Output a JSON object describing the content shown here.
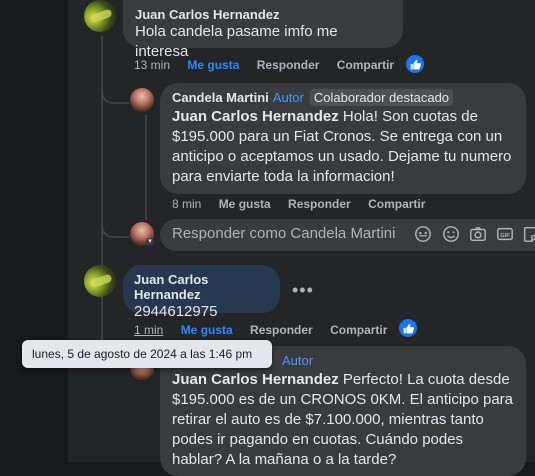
{
  "comment1": {
    "author": "Juan Carlos Hernandez",
    "text": "Hola candela pasame imfo me interesa",
    "actions": {
      "time": "13 min",
      "like": "Me gusta",
      "reply": "Responder",
      "share": "Compartir"
    }
  },
  "reply1": {
    "author": "Candela Martini",
    "author_badge": "Autor",
    "badge": "Colaborador destacado",
    "mention": "Juan Carlos Hernandez",
    "text": " Hola! Son cuotas de $195.000 para un Fiat Cronos. Se entrega con un anticipo o aceptamos un usado. Dejame tu numero para enviarte toda la informacion!",
    "actions": {
      "time": "8 min",
      "like": "Me gusta",
      "reply": "Responder",
      "share": "Compartir"
    }
  },
  "reply_input": {
    "placeholder": "Responder como Candela Martini"
  },
  "comment2": {
    "author": "Juan Carlos Hernandez",
    "text": "2944612975",
    "actions": {
      "time": "1 min",
      "like": "Me gusta",
      "reply": "Responder",
      "share": "Compartir"
    }
  },
  "reply2": {
    "author_badge": "Autor",
    "mention": "Juan Carlos Hernandez",
    "text": " Perfecto! La cuota desde $195.000 es de un CRONOS 0KM. El anticipo para retirar el auto es de $7.100.000, mientras tanto podes ir pagando en cuotas. Cuándo podes hablar? A la mañana o a la tarde?"
  },
  "tooltip": {
    "text": "lunes, 5 de agosto de 2024 a las 1:46 pm"
  },
  "colors": {
    "panel": "#242526",
    "bubble": "#3a3b3c",
    "bubble_highlight": "#263951",
    "accent": "#2d88ff"
  }
}
